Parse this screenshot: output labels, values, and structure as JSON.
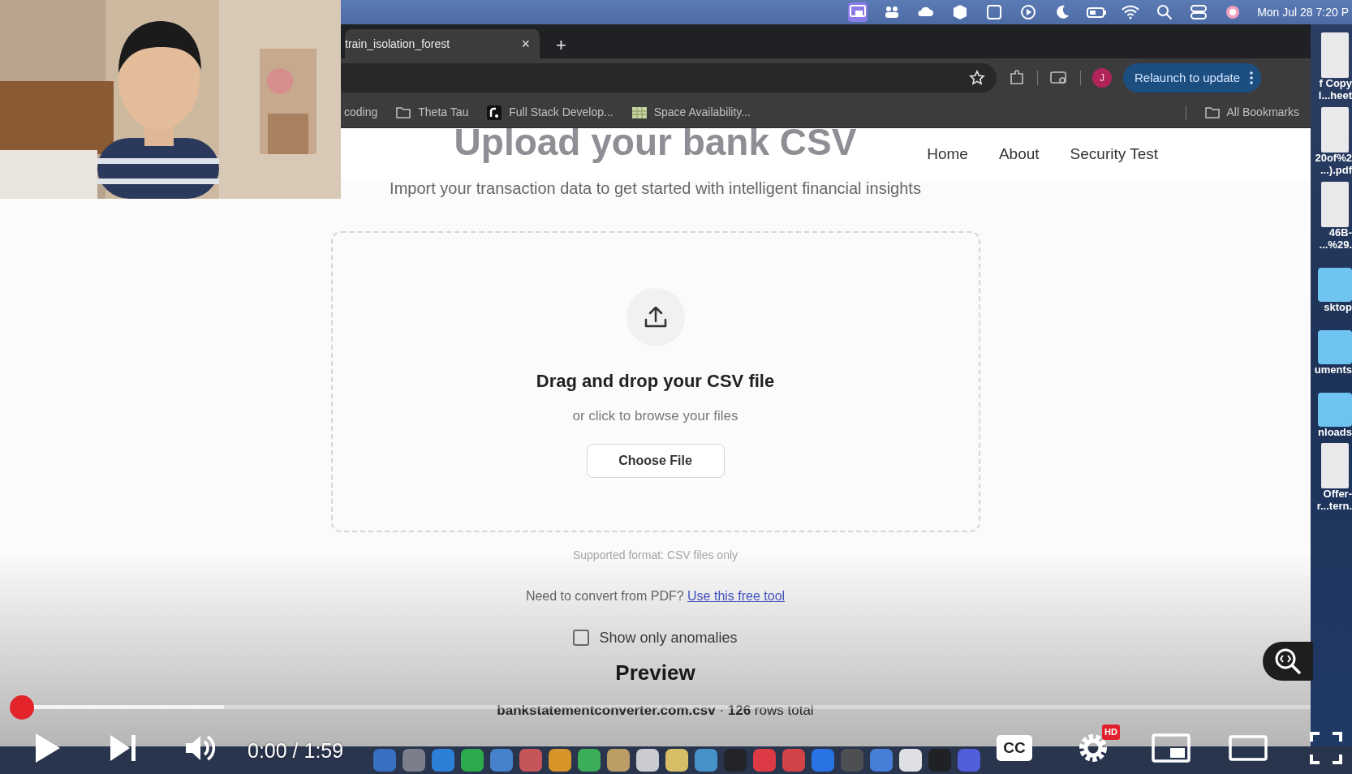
{
  "menu_bar": {
    "clock": "Mon Jul 28  7:20 P"
  },
  "browser": {
    "tabs": [
      {
        "title": "train_isolation_forest",
        "selected": true
      }
    ],
    "tab_close": "×",
    "new_tab": "+",
    "profile": "J",
    "relaunch_button": "Relaunch to update",
    "bookmarks": [
      {
        "label": "coding"
      },
      {
        "label": "Theta Tau",
        "kind": "folder"
      },
      {
        "label": "Full Stack Develop...",
        "kind": "site"
      },
      {
        "label": "Space Availability...",
        "kind": "sheet"
      }
    ],
    "all_bookmarks": "All Bookmarks"
  },
  "page": {
    "title": "Upload your bank CSV",
    "subtitle": "Import your transaction data to get started with intelligent financial insights",
    "nav": [
      {
        "label": "Home"
      },
      {
        "label": "About"
      },
      {
        "label": "Security Test"
      }
    ],
    "dropzone": {
      "heading": "Drag and drop your CSV file",
      "hint": "or click to browse your files",
      "button": "Choose File"
    },
    "format_note": "Supported format: CSV files only",
    "pdf_prompt": "Need to convert from PDF?",
    "pdf_link": "Use this free tool",
    "anomalies_filter": {
      "label": "Show only anomalies",
      "checked": false
    },
    "preview_title": "Preview",
    "file_summary": "**bankstatementconverter.com.csv** · **126** rows total"
  },
  "desktop_items": [
    {
      "kind": "file",
      "lines": [
        "f Copy",
        "l...heet"
      ]
    },
    {
      "kind": "file",
      "lines": [
        "20of%2",
        "...).pdf"
      ]
    },
    {
      "kind": "file",
      "lines": [
        "46B-",
        "...%29."
      ]
    },
    {
      "kind": "folder",
      "lines": [
        "sktop"
      ]
    },
    {
      "kind": "folder",
      "lines": [
        "uments"
      ]
    },
    {
      "kind": "folder",
      "lines": [
        "nloads"
      ]
    },
    {
      "kind": "file",
      "lines": [
        "Offer-",
        "r...tern."
      ]
    }
  ],
  "video_player": {
    "progress": {
      "level": 0
    },
    "buffered": {
      "level": 0.165
    },
    "time": "0:00 / 1:59",
    "captions": "CC",
    "quality_badge": "HD"
  }
}
